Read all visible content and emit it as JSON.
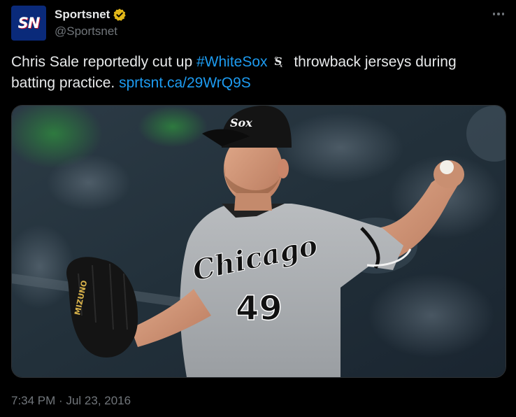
{
  "account": {
    "avatar_text": "SN",
    "display_name": "Sportsnet",
    "handle": "@Sportsnet",
    "verified_badge_color": "#e2b719"
  },
  "tweet": {
    "text_part1": "Chris Sale reportedly cut up ",
    "hashtag": "#WhiteSox",
    "emoji_icon": "white-sox-logo-icon",
    "text_part2": " throwback jerseys during batting practice. ",
    "link": "sprtsnt.ca/29WrQ9S",
    "link_color": "#1d9bf0"
  },
  "media": {
    "jersey_text": "Chicago",
    "jersey_number": "49",
    "glove_brand": "MIZUNO",
    "cap_logo": "Sox"
  },
  "footer": {
    "time": "7:34 PM",
    "separator": "·",
    "date": "Jul 23, 2016"
  },
  "colors": {
    "background": "#000000",
    "primary_text": "#e7e9ea",
    "secondary_text": "#71767b",
    "accent": "#1d9bf0"
  }
}
